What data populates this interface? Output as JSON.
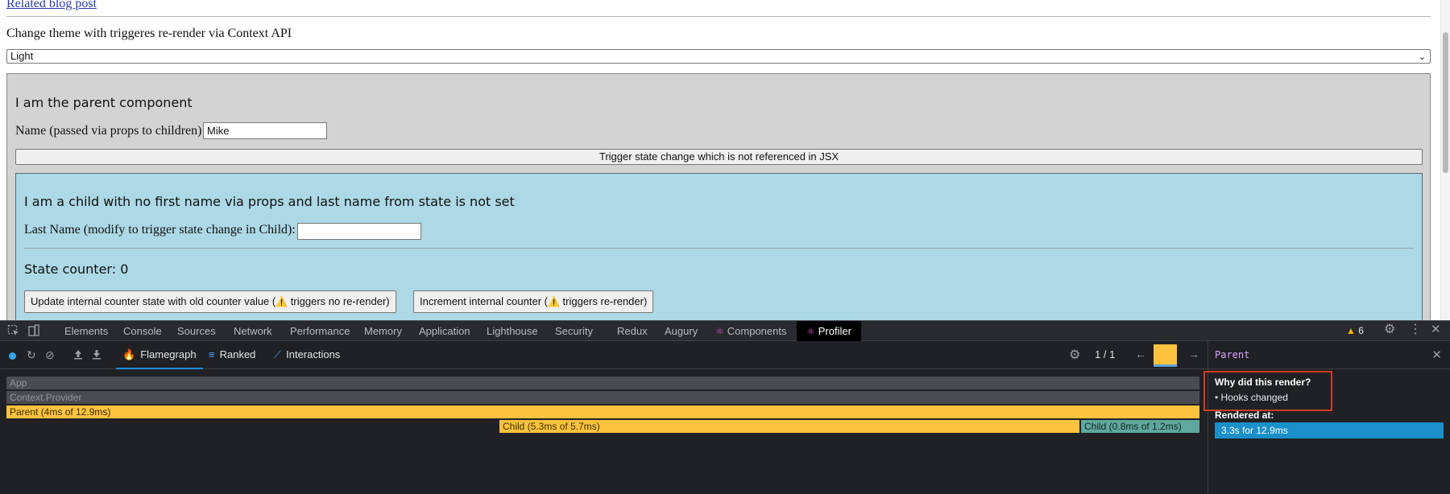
{
  "page": {
    "related_link": "Related blog post",
    "theme_label": "Change theme with triggeres re-render via Context API",
    "theme_select": {
      "value": "Light",
      "chevron": "⌄"
    },
    "parent": {
      "title": "I am the parent component",
      "name_label": "Name (passed via props to children)",
      "name_value": "Mike",
      "trigger_button": "Trigger state change which is not referenced in JSX"
    },
    "child": {
      "title": "I am a child with no first name via props and last name from state is not set",
      "last_name_label": "Last Name (modify to trigger state change in Child):",
      "last_name_value": "",
      "counter_text": "State counter: 0",
      "update_button": {
        "before": "Update internal counter state with old counter value (",
        "warn": "⚠️",
        "after": " triggers no re-render)"
      },
      "increment_button": {
        "before": "Increment internal counter (",
        "warn": "⚠️",
        "after": " triggers re-render)"
      }
    }
  },
  "devtools": {
    "tabs": [
      "Elements",
      "Console",
      "Sources",
      "Network",
      "Performance",
      "Memory",
      "Application",
      "Lighthouse",
      "Security",
      "Redux",
      "Augury",
      "Components",
      "Profiler"
    ],
    "active_tab": "Profiler",
    "warning_count": "6",
    "icons": {
      "inspect": "inspect-element-icon",
      "device": "device-toolbar-icon",
      "settings": "gear-icon",
      "more": "kebab-menu-icon",
      "close": "close-icon"
    },
    "profiler": {
      "tabs": {
        "flamegraph": "Flamegraph",
        "ranked": "Ranked",
        "interactions": "Interactions"
      },
      "commit_counter": "1 / 1",
      "flame_rows": [
        {
          "label": "App",
          "color": "#4a4c50"
        },
        {
          "label": "Context.Provider",
          "color": "#4a4c50"
        },
        {
          "label": "Parent (4ms of 12.9ms)",
          "color": "#fdc23e"
        },
        {
          "label": "Child (5.3ms of 5.7ms)",
          "color": "#fdc23e"
        },
        {
          "label": "Child (0.8ms of 1.2ms)",
          "color": "#5fa79f"
        }
      ],
      "sidebar": {
        "title": "Parent",
        "why_title": "Why did this render?",
        "why_item": "• Hooks changed",
        "rendered_title": "Rendered at:",
        "rendered_item": "3.3s for 12.9ms"
      }
    }
  }
}
